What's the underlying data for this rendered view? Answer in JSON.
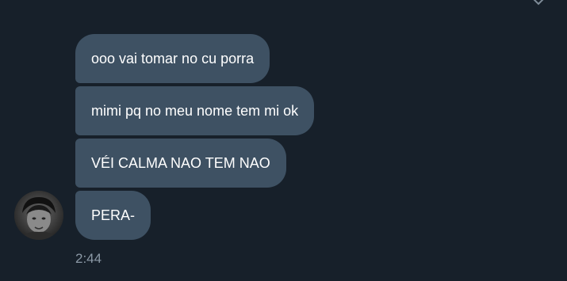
{
  "messages": [
    {
      "text": "ooo vai tomar no cu porra"
    },
    {
      "text": "mimi pq no meu nome tem mi ok"
    },
    {
      "text": "VÉI CALMA NAO TEM NAO"
    },
    {
      "text": "PERA-"
    }
  ],
  "timestamp": "2:44",
  "icons": {
    "top_right": "chevron-down-icon",
    "avatar": "user-avatar"
  },
  "colors": {
    "background": "#17202a",
    "bubble": "#3e5163",
    "text": "#ffffff",
    "timestamp": "#8b98a5"
  }
}
